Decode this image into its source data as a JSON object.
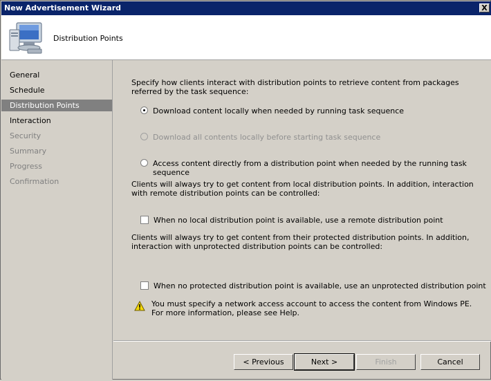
{
  "window": {
    "title": "New Advertisement Wizard",
    "close_label": "X"
  },
  "header": {
    "title": "Distribution Points",
    "icon": "computer-icon"
  },
  "sidebar": {
    "items": [
      {
        "label": "General",
        "state": "normal"
      },
      {
        "label": "Schedule",
        "state": "normal"
      },
      {
        "label": "Distribution Points",
        "state": "selected"
      },
      {
        "label": "Interaction",
        "state": "normal"
      },
      {
        "label": "Security",
        "state": "disabled"
      },
      {
        "label": "Summary",
        "state": "disabled"
      },
      {
        "label": "Progress",
        "state": "disabled"
      },
      {
        "label": "Confirmation",
        "state": "disabled"
      }
    ]
  },
  "main": {
    "intro": "Specify how clients interact with distribution points to retrieve content from packages referred by the task sequence:",
    "options": [
      {
        "label": "Download content locally when needed by running task sequence",
        "checked": true,
        "enabled": true
      },
      {
        "label": "Download all contents locally before starting task sequence",
        "checked": false,
        "enabled": false
      },
      {
        "label": "Access content directly from a distribution point when needed by the running task sequence",
        "checked": false,
        "enabled": true
      }
    ],
    "remote_text": "Clients will always try to get content from local distribution points. In addition, interaction with remote distribution points can be controlled:",
    "remote_checkbox": "When no local distribution point is available, use a remote distribution point",
    "protected_text": "Clients will always try to get content from their protected distribution points. In addition, interaction with unprotected distribution points can be controlled:",
    "protected_checkbox": "When no protected distribution point is available, use an unprotected distribution point",
    "warning": "You must specify a network access account to access the content from Windows PE.  For more information, please see Help.",
    "warning_icon": "warning-icon"
  },
  "footer": {
    "previous": "< Previous",
    "next": "Next >",
    "finish": "Finish",
    "cancel": "Cancel"
  },
  "colors": {
    "titlebar": "#0a246a",
    "selected_nav": "#808080",
    "dialog": "#d4d0c8"
  }
}
